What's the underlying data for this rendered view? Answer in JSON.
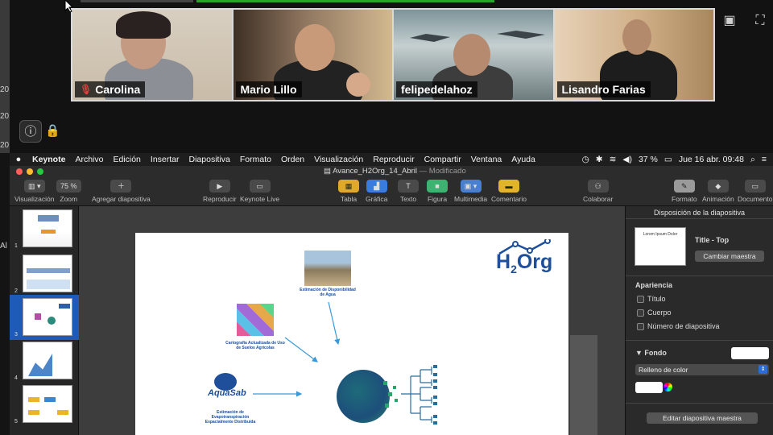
{
  "zoom": {
    "participants": [
      {
        "name": "Carolina",
        "muted": true
      },
      {
        "name": "Mario Lillo",
        "muted": false
      },
      {
        "name": "felipedelahoz",
        "muted": false
      },
      {
        "name": "Lisandro Farias",
        "muted": false
      }
    ],
    "side_numbers": [
      "20",
      "20",
      "20",
      "Al"
    ]
  },
  "menubar": {
    "app": "Keynote",
    "items": [
      "Archivo",
      "Edición",
      "Insertar",
      "Diapositiva",
      "Formato",
      "Orden",
      "Visualización",
      "Reproducir",
      "Compartir",
      "Ventana",
      "Ayuda"
    ],
    "battery": "37 %",
    "datetime": "Jue 16 abr.  09:48"
  },
  "window": {
    "title": "Avance_H2Org_14_Abril",
    "subtitle": "— Modificado"
  },
  "toolbar": {
    "visualizacion": "Visualización",
    "zoom_value": "75 %",
    "zoom": "Zoom",
    "add_slide": "Agregar diapositiva",
    "play": "Reproducir",
    "keynote_live": "Keynote Live",
    "tabla": "Tabla",
    "grafica": "Gráfica",
    "texto": "Texto",
    "figura": "Figura",
    "multimedia": "Multimedia",
    "comentario": "Comentario",
    "colaborar": "Colaborar",
    "formato": "Formato",
    "animacion": "Animación",
    "documento": "Documento"
  },
  "navigator": {
    "slides": [
      "1",
      "2",
      "3",
      "4",
      "5"
    ],
    "active_index": 2
  },
  "slide": {
    "logo": "H2Org",
    "aquasab": "AquaSab",
    "label_water": "Estimación de Disponibilidad de Agua",
    "label_crops": "Cartografía Actualizada de Uso de Suelos Agrícolas",
    "label_aquasab": "Estimación de Evapotranspiración Espacialmente Distribuida"
  },
  "inspector": {
    "header": "Disposición de la diapositiva",
    "layout_thumb_text": "Lorem Ipsum Dolor",
    "layout_name": "Title - Top",
    "change_master": "Cambiar maestra",
    "appearance": "Apariencia",
    "titulo": "Título",
    "cuerpo": "Cuerpo",
    "numero": "Número de diapositiva",
    "fondo": "Fondo",
    "fill_type": "Relleno de color",
    "edit_master": "Editar diapositiva maestra"
  }
}
